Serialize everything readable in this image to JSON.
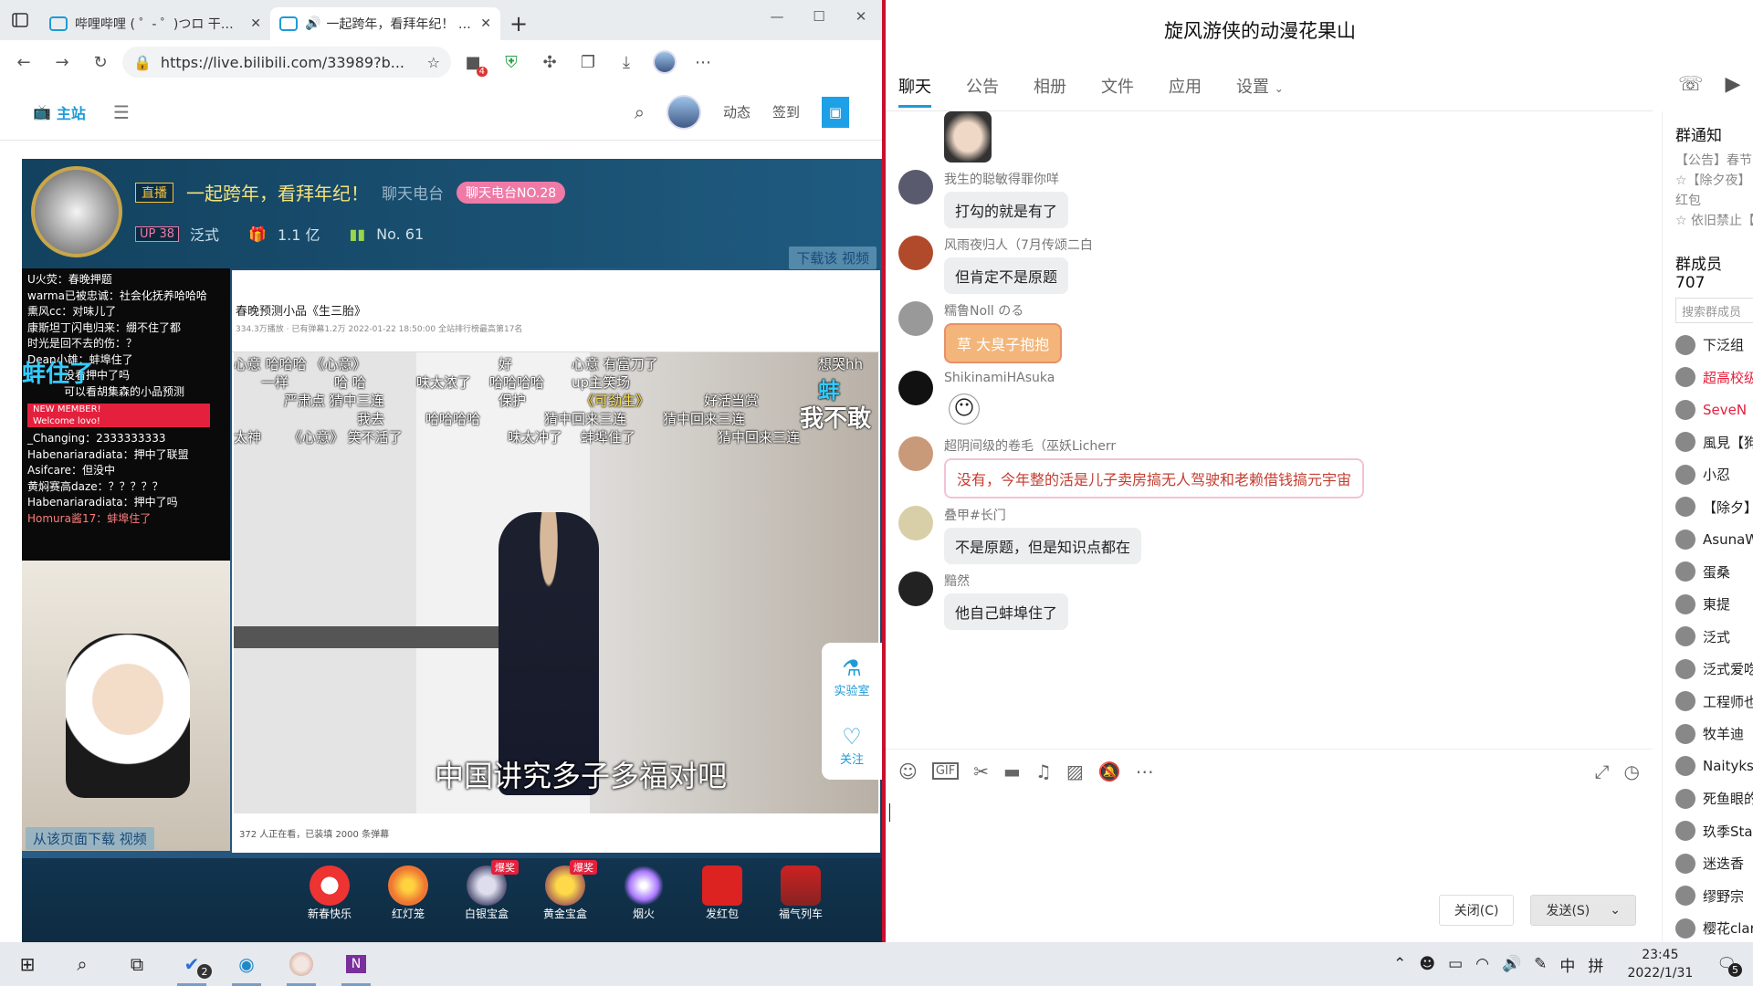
{
  "browser": {
    "tabs": [
      {
        "title": "哔哩哔哩 ( ゜- ゜)つロ 干杯~-bilibili"
      },
      {
        "title": "一起跨年，看拜年纪！ - 泛式"
      }
    ],
    "url": "https://live.bilibili.com/33989?b...",
    "badge_count": "4"
  },
  "bili": {
    "home_label": "主站",
    "nav_dynamic": "动态",
    "nav_signin": "签到"
  },
  "room": {
    "live_tag": "直播",
    "title": "一起跨年，看拜年纪！",
    "category": "聊天电台",
    "rank_badge": "聊天电台NO.28",
    "up_level": "UP 38",
    "up_name": "泛式",
    "popularity": "1.1 亿",
    "rank": "No. 61",
    "download_video": "下载该 视频",
    "download_page": "从该页面下载 视频"
  },
  "danmu_panel": {
    "lines": [
      "U火荧：春晚押题",
      "warma已被忠诚：社会化抚养哈哈哈",
      "熏风cc：对味儿了",
      "康斯坦丁闪电归来：绷不住了都",
      "时光是回不去的伤：？",
      "Dean小雄：蚌埠住了",
      "没看押中了吗",
      "可以看胡集森的小品预测"
    ],
    "new_member": "NEW MEMBER!",
    "welcome": "Welcome lovo!",
    "lines2": [
      "_Changing：2333333333",
      "Habenariaradiata：押中了联盟",
      "Asifcare：但没中",
      "黄焖赛高daze：？？？？？",
      "Habenariaradiata：押中了吗",
      "Homura酱17：蚌埠住了"
    ],
    "big_text": "蚌住了"
  },
  "video": {
    "page_title": "春晚预测小品《生三胎》",
    "page_meta": "334.3万播放 · 已有弹幕1.2万   2022-01-22 18:50:00   全站排行榜最高第17名",
    "danmaku": [
      "心意 哈哈哈 《心意》",
      "好",
      "心意 有富刀了",
      "想哭hh",
      "一样",
      "哈 哈",
      "味太浓了",
      "哈哈哈哈",
      "up主笑场",
      "严肃点 猜中三连",
      "保护",
      "《可劲生》",
      "好活当赏",
      "我去",
      "哈哈哈哈",
      "猜中回来三连",
      "猜中回来三连",
      "太神",
      "《心意》 笑不活了",
      "味太冲了",
      "蚌埠住了",
      "猜中回来三连",
      "蚌埠",
      "我不敢",
      "蚌"
    ],
    "subtitle": "中国讲究多子多福对吧",
    "bottom_meta": "372 人正在看，已装填 2000 条弹幕",
    "lab": "实验室",
    "follow": "关注"
  },
  "gifts": [
    {
      "name": "新春快乐",
      "hot": ""
    },
    {
      "name": "红灯笼",
      "hot": ""
    },
    {
      "name": "白银宝盒",
      "hot": "爆奖"
    },
    {
      "name": "黄金宝盒",
      "hot": "爆奖"
    },
    {
      "name": "烟火",
      "hot": ""
    },
    {
      "name": "发红包",
      "hot": ""
    },
    {
      "name": "福气列车",
      "hot": ""
    }
  ],
  "qq": {
    "group_title": "旋风游侠的动漫花果山",
    "tabs": [
      "聊天",
      "公告",
      "相册",
      "文件",
      "应用",
      "设置"
    ],
    "messages": [
      {
        "name": "我生的聪敏得罪你咩",
        "text": "打勾的就是有了",
        "style": "normal",
        "color": "#5a5a6e"
      },
      {
        "name": "风雨夜归人（7月传颂二白",
        "text": "但肯定不是原题",
        "style": "normal",
        "color": "#b04a2a"
      },
      {
        "name": "糯鲁Noll のる",
        "text": "草 大臭子抱抱",
        "style": "orange",
        "color": "#999"
      },
      {
        "name": "ShikinamiHAsuka",
        "text": "",
        "style": "sticker",
        "color": "#111"
      },
      {
        "name": "超阴间级的卷毛（巫妖Licherr",
        "text": "没有，今年整的活是儿子卖房搞无人驾驶和老赖借钱搞元宇宙",
        "style": "pink",
        "color": "#c89a7a"
      },
      {
        "name": "叠甲#长门",
        "text": "不是原题，但是知识点都在",
        "style": "normal",
        "color": "#e8e0c0"
      },
      {
        "name": "黯然",
        "text": "他自己蚌埠住了",
        "style": "normal",
        "color": "#222"
      }
    ],
    "close_label": "关闭(C)",
    "send_label": "发送(S)",
    "notice_title": "群通知",
    "notice_lines": [
      "【公告】春节",
      "☆【除夕夜】",
      "红包",
      "☆ 依旧禁止【"
    ],
    "members_title": "群成员 707",
    "member_search": "搜索群成员",
    "members": [
      {
        "name": "下泛组",
        "red": false
      },
      {
        "name": "超高校级",
        "red": true
      },
      {
        "name": "SeveN",
        "red": true
      },
      {
        "name": "風見【狗",
        "red": false
      },
      {
        "name": "小忍",
        "red": false
      },
      {
        "name": "【除夕】",
        "red": false
      },
      {
        "name": "AsunaW",
        "red": false
      },
      {
        "name": "蛋桑",
        "red": false
      },
      {
        "name": "東提",
        "red": false
      },
      {
        "name": "泛式",
        "red": false
      },
      {
        "name": "泛式爱吃",
        "red": false
      },
      {
        "name": "工程师也",
        "red": false
      },
      {
        "name": "牧羊迪",
        "red": false
      },
      {
        "name": "Naityks",
        "red": false
      },
      {
        "name": "死鱼眼的",
        "red": false
      },
      {
        "name": "玖季Sta",
        "red": false
      },
      {
        "name": "迷迭香",
        "red": false
      },
      {
        "name": "缪野宗",
        "red": false
      },
      {
        "name": "樱花clar",
        "red": false
      }
    ]
  },
  "taskbar": {
    "todo_badge": "2",
    "ime1": "中",
    "ime2": "拼",
    "time": "23:45",
    "date": "2022/1/31",
    "notif_count": "5"
  }
}
